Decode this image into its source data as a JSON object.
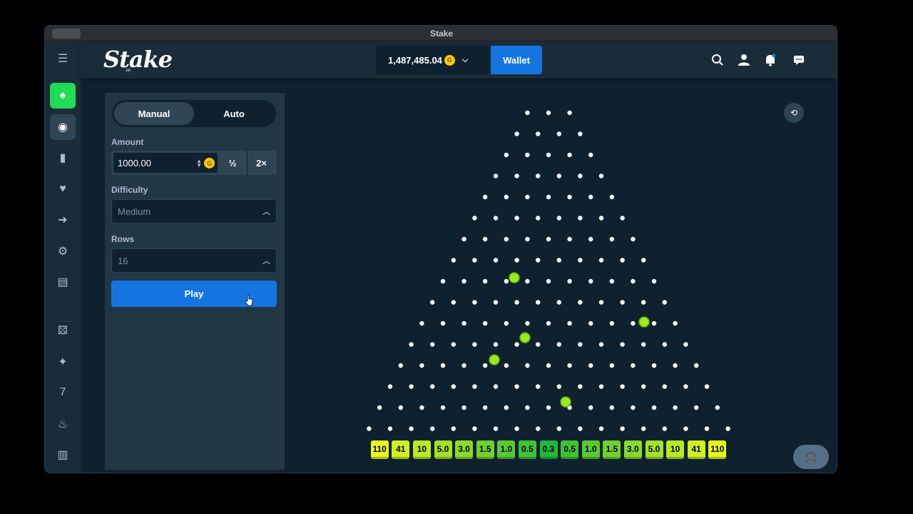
{
  "window": {
    "title": "Stake"
  },
  "header": {
    "logo": "Stake",
    "logo_sub": ".us",
    "balance": "1,487,485.04",
    "currency_icon": "G",
    "wallet_label": "Wallet",
    "icons": [
      "search-icon",
      "user-icon",
      "bell-icon",
      "chat-icon"
    ]
  },
  "sidebar": {
    "items": [
      "menu-icon",
      "casino-icon",
      "sports-icon",
      "bookmark-icon",
      "heart-icon",
      "arrow-right-icon",
      "gear-icon",
      "notes-icon",
      "dice-icon",
      "sparkle-icon",
      "sevens-icon",
      "fire-icon",
      "vest-icon"
    ]
  },
  "controls": {
    "tabs": [
      "Manual",
      "Auto"
    ],
    "active_tab": "Manual",
    "amount_label": "Amount",
    "amount_value": "1000.00",
    "half_label": "½",
    "double_label": "2×",
    "difficulty_label": "Difficulty",
    "difficulty_value": "Medium",
    "rows_label": "Rows",
    "rows_value": "16",
    "play_label": "Play"
  },
  "board": {
    "rows": 16,
    "multipliers": [
      "110",
      "41",
      "10",
      "5.0",
      "3.0",
      "1.5",
      "1.0",
      "0.5",
      "0.3",
      "0.5",
      "1.0",
      "1.5",
      "3.0",
      "5.0",
      "10",
      "41",
      "110"
    ],
    "colors": {
      "peg": "#ffffff",
      "ball": "#9aea1f",
      "edge": "#c8f21c",
      "center": "#1fb83a"
    }
  }
}
